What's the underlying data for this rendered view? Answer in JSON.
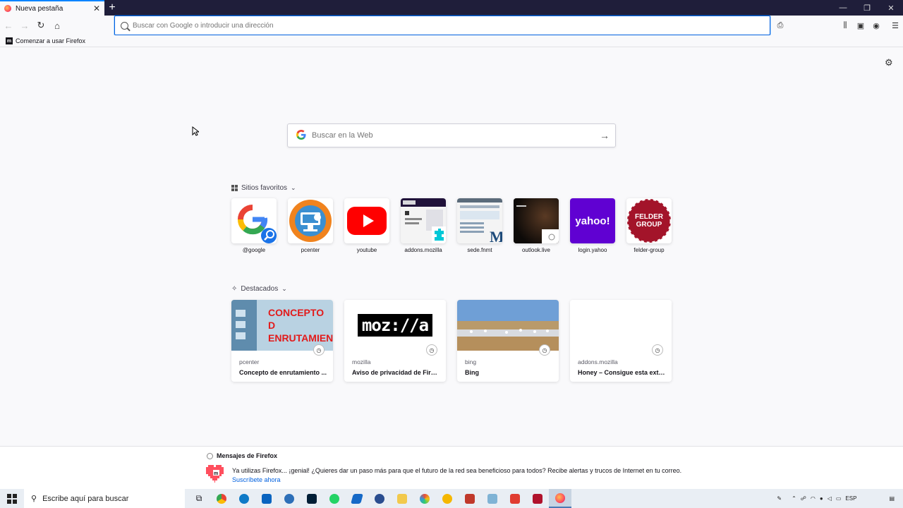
{
  "browser": {
    "tab_title": "Nueva pestaña",
    "url_placeholder": "Buscar con Google o introducir una dirección",
    "bookmark_label": "Comenzar a usar Firefox"
  },
  "newtab": {
    "search_placeholder": "Buscar en la Web",
    "top_sites_heading": "Sitios favoritos",
    "top_sites": [
      {
        "label": "@google"
      },
      {
        "label": "pcenter"
      },
      {
        "label": "youtube"
      },
      {
        "label": "addons.mozilla"
      },
      {
        "label": "sede.fnmt"
      },
      {
        "label": "outlook.live"
      },
      {
        "label": "login.yahoo"
      },
      {
        "label": "felder-group"
      }
    ],
    "yahoo_text": "yahoo!",
    "felder_text_1": "FELDER",
    "felder_text_2": "GROUP",
    "highlights_heading": "Destacados",
    "highlights": [
      {
        "source": "pcenter",
        "title": "Concepto de enrutamiento ...",
        "image_text": "CONCEPTO D ENRUTAMIEN"
      },
      {
        "source": "mozilla",
        "title": "Aviso de privacidad de Firef...",
        "image_text": "moz://a"
      },
      {
        "source": "bing",
        "title": "Bing"
      },
      {
        "source": "addons.mozilla",
        "title": "Honey – Consigue esta exte..."
      }
    ]
  },
  "messages": {
    "heading": "Mensajes de Firefox",
    "text": "Ya utilizas Firefox... ¡genial! ¿Quieres dar un paso más para que el futuro de la red sea beneficioso para todos? Recibe alertas y trucos de Internet en tu correo.",
    "link": "Suscríbete ahora"
  },
  "taskbar": {
    "search_placeholder": "Escribe aquí para buscar",
    "language": "ESP"
  },
  "colors": {
    "accent": "#0060df",
    "tabstrip": "#1f1e3a",
    "youtube": "#ff0000",
    "yahoo": "#6001d2",
    "felder": "#a3142a"
  }
}
